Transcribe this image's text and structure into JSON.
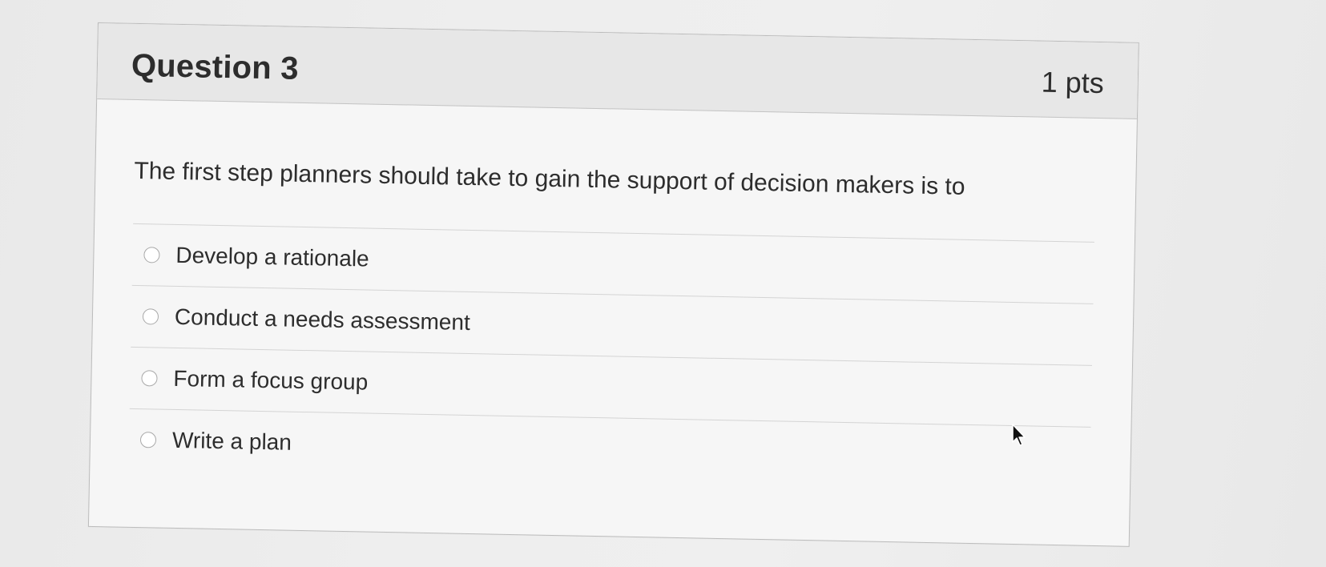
{
  "question": {
    "title": "Question 3",
    "points": "1 pts",
    "text": "The first step planners should take to gain the support of decision makers is to",
    "answers": [
      {
        "label": "Develop a rationale",
        "selected": false
      },
      {
        "label": "Conduct a needs assessment",
        "selected": false
      },
      {
        "label": "Form a focus group",
        "selected": false
      },
      {
        "label": "Write a plan",
        "selected": false
      }
    ]
  },
  "icons": {
    "cursor": "mouse-pointer-icon"
  }
}
